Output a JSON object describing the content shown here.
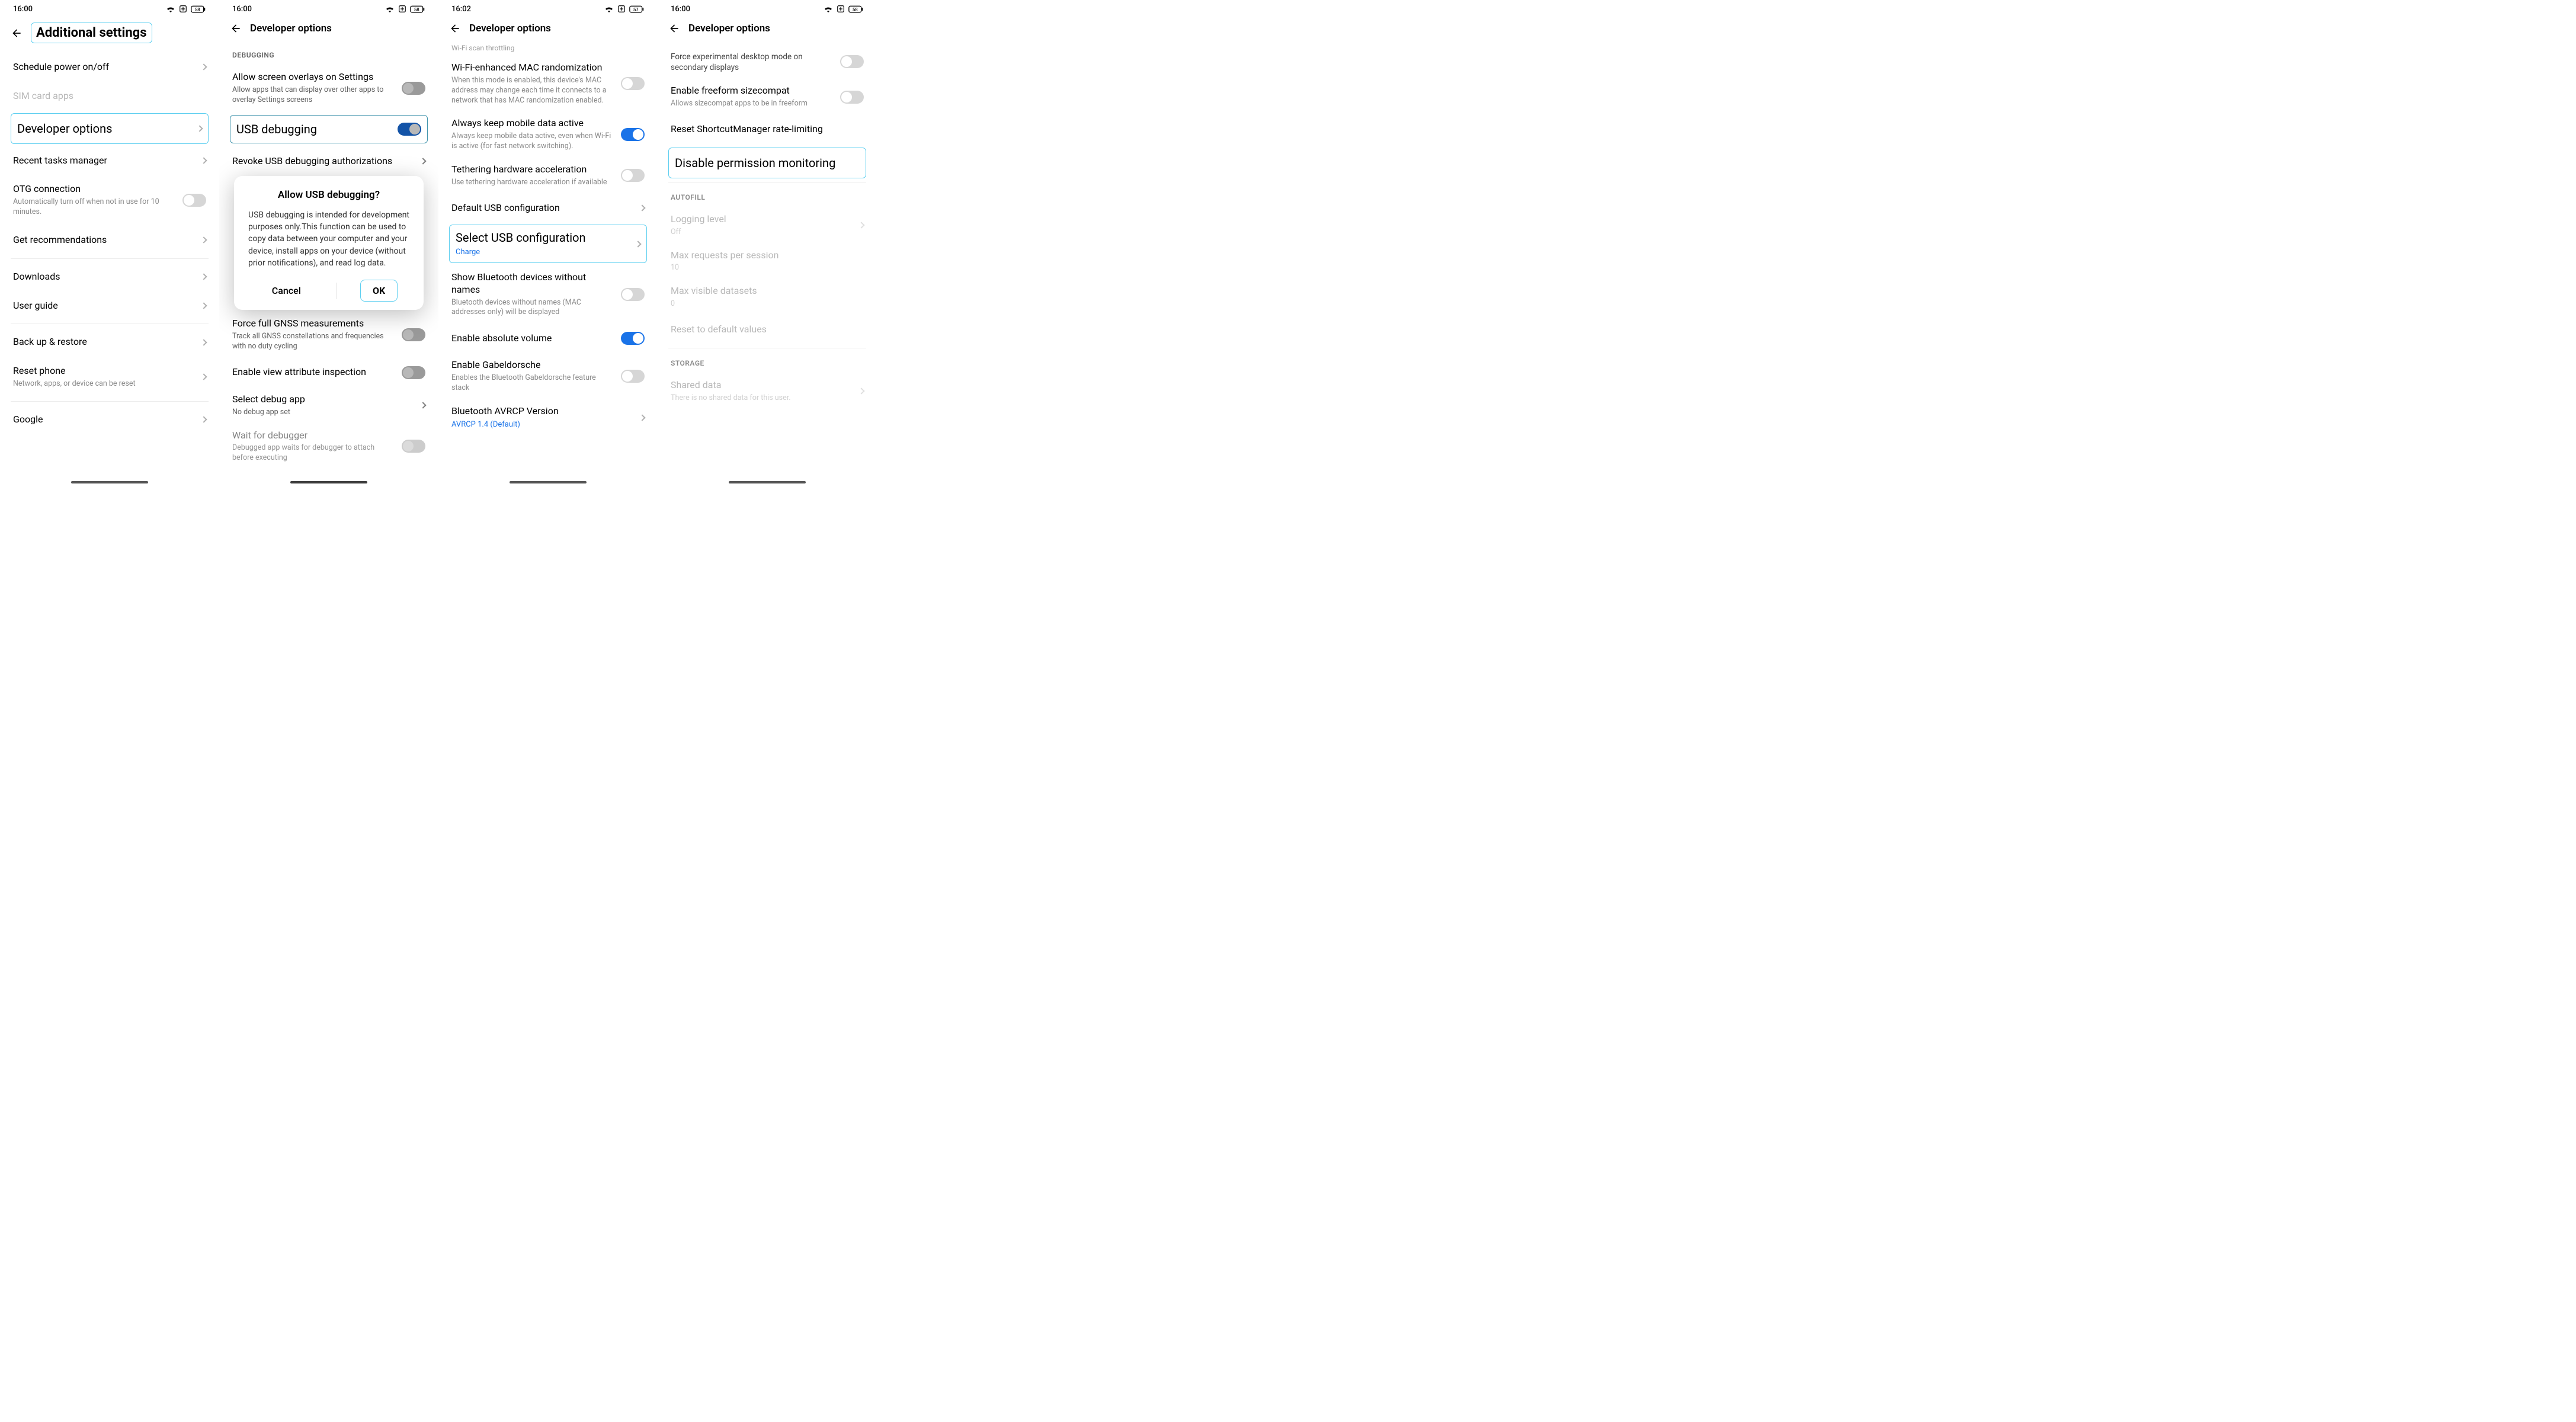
{
  "status": {
    "time_a": "16:00",
    "time_b": "16:02",
    "battery": "58",
    "battery_b": "57"
  },
  "s1": {
    "title": "Additional settings",
    "items": {
      "schedule": "Schedule power on/off",
      "sim": "SIM card apps",
      "dev": "Developer options",
      "recent": "Recent tasks manager",
      "otg_t": "OTG connection",
      "otg_s": "Automatically turn off when not in use for 10 minutes.",
      "rec": "Get recommendations",
      "dl": "Downloads",
      "guide": "User guide",
      "backup": "Back up & restore",
      "reset_t": "Reset phone",
      "reset_s": "Network, apps, or device can be reset",
      "google": "Google"
    }
  },
  "s2": {
    "title": "Developer options",
    "sec_debug": "DEBUGGING",
    "overlay_t": "Allow screen overlays on Settings",
    "overlay_s": "Allow apps that can display over other apps to overlay Settings screens",
    "usb": "USB debugging",
    "revoke": "Revoke USB debugging authorizations",
    "gnss_t": "Force full GNSS measurements",
    "gnss_s": "Track all GNSS constellations and frequencies with no duty cycling",
    "view_attr": "Enable view attribute inspection",
    "sel_debug_t": "Select debug app",
    "sel_debug_s": "No debug app set",
    "wait_t": "Wait for debugger",
    "wait_s": "Debugged app waits for debugger to attach before executing",
    "dialog": {
      "title": "Allow USB debugging?",
      "body": "USB debugging is intended for development purposes only.This function can be used to copy data between your computer and your device, install apps on your device (without prior notifications), and read log data.",
      "cancel": "Cancel",
      "ok": "OK"
    }
  },
  "s3": {
    "title": "Developer options",
    "cut": "Wi-Fi scan throttling",
    "mac_t": "Wi-Fi-enhanced MAC randomization",
    "mac_s": "When this mode is enabled, this device's MAC address may change each time it connects to a network that has MAC randomization enabled.",
    "mdata_t": "Always keep mobile data active",
    "mdata_s": "Always keep mobile data active, even when Wi-Fi is active (for fast network switching).",
    "teth_t": "Tethering hardware acceleration",
    "teth_s": "Use tethering hardware acceleration if available",
    "defusb": "Default USB configuration",
    "selusb_t": "Select USB configuration",
    "selusb_s": "Charge",
    "bt_noname_t": "Show Bluetooth devices without names",
    "bt_noname_s": "Bluetooth devices without names (MAC addresses only) will be displayed",
    "abs_vol": "Enable absolute volume",
    "gabel_t": "Enable Gabeldorsche",
    "gabel_s": "Enables the Bluetooth Gabeldorsche feature stack",
    "avrcp_t": "Bluetooth AVRCP Version",
    "avrcp_s": "AVRCP 1.4 (Default)"
  },
  "s4": {
    "title": "Developer options",
    "desk_t": "Force experimental desktop mode on secondary displays",
    "free_t": "Enable freeform sizecompat",
    "free_s": "Allows sizecompat apps to be in freeform",
    "reset_sc": "Reset ShortcutManager rate-limiting",
    "disable_perm": "Disable permission monitoring",
    "sec_autofill": "AUTOFILL",
    "log_t": "Logging level",
    "log_s": "Off",
    "maxreq_t": "Max requests per session",
    "maxreq_s": "10",
    "maxvis_t": "Max visible datasets",
    "maxvis_s": "0",
    "reset_def": "Reset to default values",
    "sec_storage": "STORAGE",
    "shared_t": "Shared data",
    "shared_s": "There is no shared data for this user."
  }
}
